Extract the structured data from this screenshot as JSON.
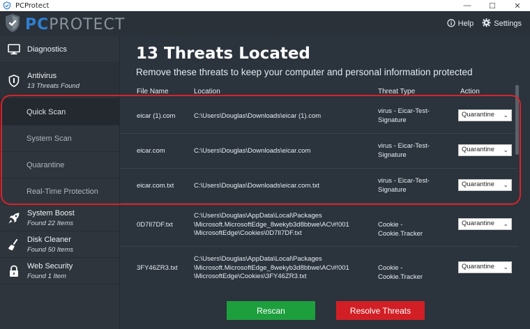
{
  "window": {
    "title": "PCProtect",
    "controls": [
      "—",
      "☐",
      "✕"
    ]
  },
  "header": {
    "logo_pc": "PC",
    "logo_rest": "PROTECT",
    "help_label": "Help",
    "settings_label": "Settings"
  },
  "sidebar": {
    "diagnostics": {
      "label": "Diagnostics"
    },
    "antivirus": {
      "label": "Antivirus",
      "sub": "13 Threats Found"
    },
    "antivirus_items": [
      {
        "label": "Quick Scan"
      },
      {
        "label": "System Scan"
      },
      {
        "label": "Quarantine"
      },
      {
        "label": "Real-Time Protection"
      }
    ],
    "system_boost": {
      "label": "System Boost",
      "sub": "Found 22 Items"
    },
    "disk_cleaner": {
      "label": "Disk Cleaner",
      "sub": "Found 50 Items"
    },
    "web_security": {
      "label": "Web Security",
      "sub": "Found 1 Item"
    }
  },
  "main": {
    "heading": "13 Threats Located",
    "subheading": "Remove these threats to keep your computer and personal information protected",
    "columns": {
      "file_name": "File Name",
      "location": "Location",
      "threat_type": "Threat Type",
      "action": "Action"
    },
    "rows": [
      {
        "file": "eicar (1).com",
        "location": [
          "C:\\Users\\Douglas\\Downloads\\eicar (1).com"
        ],
        "threat": [
          "virus  -  Eicar-Test-",
          "Signature"
        ],
        "action": "Quarantine"
      },
      {
        "file": "eicar.com",
        "location": [
          "C:\\Users\\Douglas\\Downloads\\eicar.com"
        ],
        "threat": [
          "virus  -  Eicar-Test-",
          "Signature"
        ],
        "action": "Quarantine"
      },
      {
        "file": "eicar.com.txt",
        "location": [
          "C:\\Users\\Douglas\\Downloads\\eicar.com.txt"
        ],
        "threat": [
          "virus  -  Eicar-Test-",
          "Signature"
        ],
        "action": "Quarantine"
      },
      {
        "file": "0D7lI7DF.txt",
        "location": [
          "C:\\Users\\Douglas\\AppData\\Local\\Packages",
          "\\Microsoft.MicrosoftEdge_8wekyb3d8bbwe\\AC\\#!001",
          "\\MicrosoftEdge\\Cookies\\0D7lI7DF.txt"
        ],
        "threat": [
          "Cookie  -  Cookie.Tracker"
        ],
        "action": "Quarantine"
      },
      {
        "file": "3FY46ZR3.txt",
        "location": [
          "C:\\Users\\Douglas\\AppData\\Local\\Packages",
          "\\Microsoft.MicrosoftEdge_8wekyb3d8bbwe\\AC\\#!001",
          "\\MicrosoftEdge\\Cookies\\3FY46ZR3.txt"
        ],
        "threat": [
          "Cookie  -  Cookie.Tracker"
        ],
        "action": "Quarantine"
      }
    ],
    "rescan_label": "Rescan",
    "resolve_label": "Resolve Threats"
  },
  "colors": {
    "accent_blue": "#2f7fd1",
    "rescan_green": "#1e9f3e",
    "resolve_red": "#d11f25",
    "highlight_red": "#d9222a"
  }
}
